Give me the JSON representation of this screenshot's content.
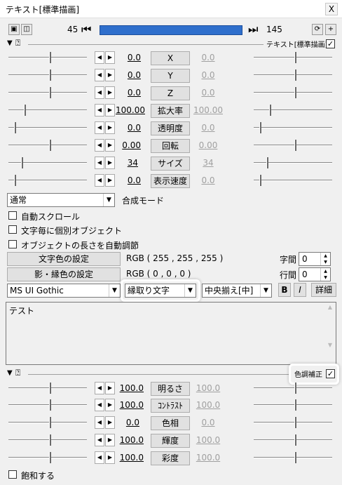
{
  "window": {
    "title": "テキスト[標準描画]",
    "close_glyph": "X"
  },
  "frame": {
    "start": "45",
    "end": "145",
    "seek_color": "#2f6fcc"
  },
  "section1": {
    "label": "テキスト[標準描画]",
    "enabled": true
  },
  "params1": [
    {
      "start": "0.0",
      "label": "X",
      "end": "0.0"
    },
    {
      "start": "0.0",
      "label": "Y",
      "end": "0.0"
    },
    {
      "start": "0.0",
      "label": "Z",
      "end": "0.0"
    },
    {
      "start": "100.00",
      "label": "拡大率",
      "end": "100.00"
    },
    {
      "start": "0.0",
      "label": "透明度",
      "end": "0.0"
    },
    {
      "start": "0.00",
      "label": "回転",
      "end": "0.00"
    },
    {
      "start": "34",
      "label": "サイズ",
      "end": "34"
    },
    {
      "start": "0.0",
      "label": "表示速度",
      "end": "0.0"
    }
  ],
  "blend": {
    "value": "通常",
    "label": "合成モード"
  },
  "options": [
    {
      "label": "自動スクロール",
      "checked": false
    },
    {
      "label": "文字毎に個別オブジェクト",
      "checked": false
    },
    {
      "label": "オブジェクトの長さを自動調節",
      "checked": false
    }
  ],
  "colors": {
    "text_color_button": "文字色の設定",
    "text_color_value": "RGB ( 255 , 255 , 255 )",
    "shadow_color_button": "影・縁色の設定",
    "shadow_color_value": "RGB ( 0 , 0 , 0 )"
  },
  "spacing": {
    "char_label": "字間",
    "char_value": "0",
    "line_label": "行間",
    "line_value": "0"
  },
  "font": {
    "family": "MS UI Gothic",
    "decoration": "縁取り文字",
    "align": "中央揃え[中]",
    "bold_label": "B",
    "italic_label": "I",
    "detail_label": "詳細"
  },
  "text_content": "テスト",
  "section2": {
    "label": "色調補正",
    "enabled": true
  },
  "params2": [
    {
      "start": "100.0",
      "label": "明るさ",
      "end": "100.0"
    },
    {
      "start": "100.0",
      "label": "ｺﾝﾄﾗｽﾄ",
      "end": "100.0"
    },
    {
      "start": "0.0",
      "label": "色相",
      "end": "0.0"
    },
    {
      "start": "100.0",
      "label": "輝度",
      "end": "100.0"
    },
    {
      "start": "100.0",
      "label": "彩度",
      "end": "100.0"
    }
  ],
  "saturate": {
    "label": "飽和する",
    "checked": false
  }
}
